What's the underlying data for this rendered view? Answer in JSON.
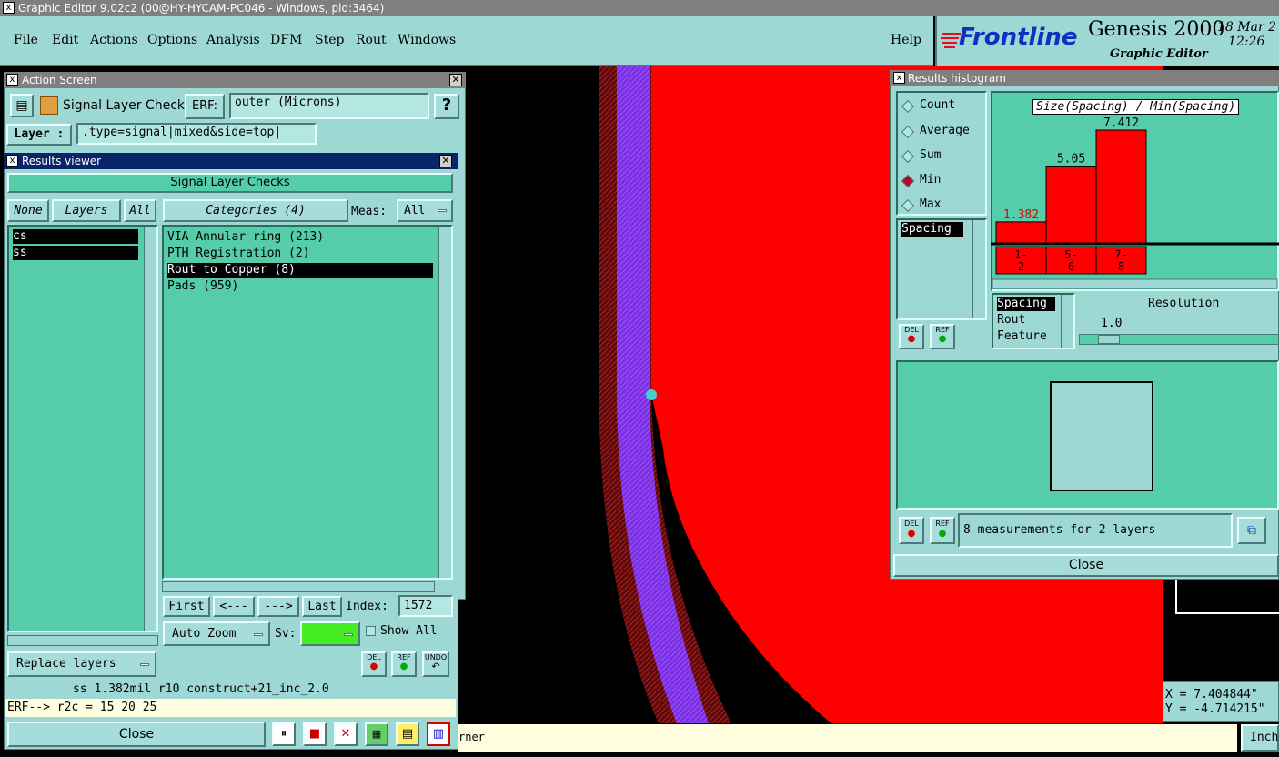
{
  "app_title": "Graphic Editor 9.02c2 (00@HY-HYCAM-PC046 - Windows, pid:3464)",
  "menu": [
    "File",
    "Edit",
    "Actions",
    "Options",
    "Analysis",
    "DFM",
    "Step",
    "Rout",
    "Windows"
  ],
  "help_label": "Help",
  "brand": {
    "logo": "Frontline",
    "product": "Genesis 2000",
    "subtitle": "Graphic Editor",
    "date": "18 Mar 2",
    "time": "12:26"
  },
  "action_screen": {
    "title": "Action Screen",
    "name": "Signal Layer Checks",
    "erf_label": "ERF:",
    "erf_value": "outer (Microns)",
    "help": "?",
    "layer_label": "Layer :",
    "layer_value": ".type=signal|mixed&side=top|"
  },
  "results_viewer": {
    "title": "Results viewer",
    "header": "Signal Layer Checks",
    "none_btn": "None",
    "layers_btn": "Layers",
    "all_btn": "All",
    "layers": [
      "cs",
      "ss"
    ],
    "categories_btn": "Categories (4)",
    "meas_label": "Meas:",
    "meas_value": "All",
    "categories": [
      "VIA Annular ring (213)",
      "PTH Registration (2)",
      "Rout to Copper (8)",
      "Pads (959)"
    ],
    "selected_category": 2,
    "first": "First",
    "prev": "<---",
    "next": "--->",
    "last": "Last",
    "index_label": "Index:",
    "index_value": "1572",
    "auto_zoom": "Auto Zoom",
    "sv_label": "Sv:",
    "show_all": "Show All",
    "replace_layers": "Replace layers",
    "del": "DEL",
    "ref": "REF",
    "undo": "UNDO",
    "status": "ss 1.382mil  r10  construct+21_inc_2.0",
    "erf_line": "ERF--> r2c = 15 20 25",
    "close": "Close"
  },
  "histogram": {
    "title": "Results histogram",
    "modes": [
      "Count",
      "Average",
      "Sum",
      "Min",
      "Max"
    ],
    "selected_mode": 3,
    "chart_title": "Size(Spacing) / Min(Spacing)",
    "list_item": "Spacing",
    "sub_list": [
      "Spacing",
      "Rout",
      "Feature"
    ],
    "resolution_label": "Resolution",
    "resolution_value": "1.0",
    "del": "DEL",
    "ref": "REF",
    "status": "8 measurements for 2 layers",
    "close": "Close",
    "bar_color": "#ff0000"
  },
  "chart_data": {
    "type": "bar",
    "title": "Size(Spacing) / Min(Spacing)",
    "categories": [
      "1-2",
      "5-6",
      "7-8"
    ],
    "values": [
      1.382,
      5.05,
      7.412
    ],
    "value_labels": [
      "1.382",
      "5.05",
      "7.412"
    ],
    "ylim": [
      0,
      7.412
    ]
  },
  "bottom": {
    "message": "rner",
    "units": "Inch"
  },
  "coords": {
    "x": "X = 7.404844\"",
    "y": "Y = -4.714215\""
  }
}
